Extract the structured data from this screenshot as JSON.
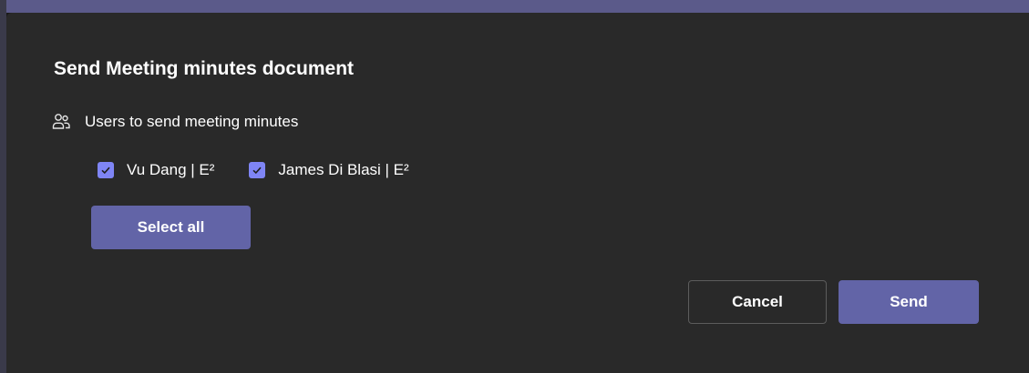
{
  "dialog": {
    "title": "Send Meeting minutes document",
    "section_label": "Users to send meeting minutes",
    "section_icon": "people-icon",
    "users": [
      {
        "label": "Vu Dang | E²",
        "checked": true
      },
      {
        "label": "James Di Blasi | E²",
        "checked": true
      }
    ],
    "select_all_label": "Select all",
    "cancel_label": "Cancel",
    "send_label": "Send"
  },
  "colors": {
    "accent": "#6264a7",
    "checkbox": "#7f85f5",
    "dialog_bg": "#292929",
    "text": "#ffffff"
  }
}
